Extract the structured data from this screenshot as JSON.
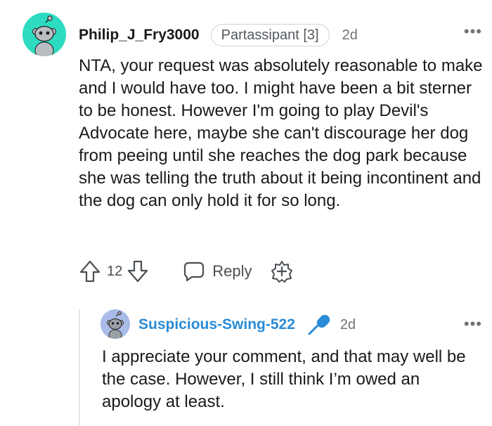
{
  "comment": {
    "username": "Philip_J_Fry3000",
    "flair": "Partassipant [3]",
    "time": "2d",
    "more": "•••",
    "avatar_color": "#2ddcc0",
    "body": "NTA, your request was absolutely reasonable to make and I would have too. I might have been a bit sterner to be honest. However I'm going to play Devil's Advocate here, maybe she can't discourage her dog from peeing until she reaches the dog park because she was telling the truth about it being incontinent and the dog can only hold it for so long.",
    "score": "12",
    "reply_label": "Reply",
    "icons": [
      "upvote-icon",
      "downvote-icon",
      "reply-icon",
      "award-icon"
    ]
  },
  "reply": {
    "username": "Suspicious-Swing-522",
    "username_color": "#2a8bd6",
    "time": "2d",
    "more": "•••",
    "avatar_color": "#a9bce8",
    "badge_icon": "microphone-icon",
    "body": "I appreciate your comment, and that may well be the case. However, I still think I’m owed an apology at least."
  }
}
